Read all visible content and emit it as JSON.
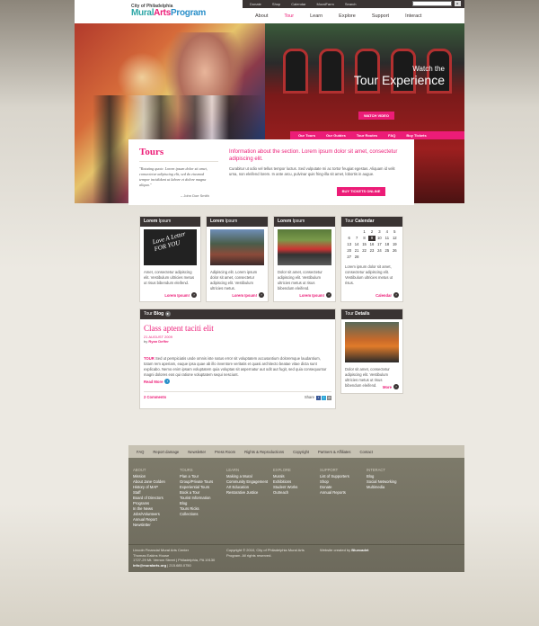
{
  "header": {
    "logo_top": "City of Philadelphia",
    "logo_a": "Mural",
    "logo_b": "Arts",
    "logo_c": "Program",
    "utility": [
      "Donate",
      "Shop",
      "Calendar",
      "MuralFarm"
    ],
    "search_label": "Search",
    "nav": [
      "About",
      "Tour",
      "Learn",
      "Explore",
      "Support",
      "Interact"
    ],
    "nav_active": "Tour"
  },
  "hero": {
    "watch": "Watch the",
    "experience": "Tour Experience",
    "watch_button": "WATCH VIDEO"
  },
  "subnav": [
    "Our Tours",
    "Our Guides",
    "Tour Routes",
    "FAQ",
    "Buy Tickets"
  ],
  "intro": {
    "title": "Tours",
    "quote": "\"Rotating quote. Lorem ipsum dolor sit amet, consectetur adipiscing elit, sed do eiusmod tempor incididunt ut labore et dolore magna aliqua.\"",
    "quote_by": "– John Doe Smith",
    "lead": "Information about the section. Lorem ipsum dolor sit amet, consectetur adipiscing elit.",
    "body": "Curabitur ut odio vel tellus tempor luctus. Sed vulputate mi ac tortor feugiat egestas. Aliquam id velit urna, non eleifend lorem. In ante arcu, pulvinar quis fring-illa sit amet, lobortis in augue.",
    "buy_button": "BUY TICKETS ONLINE"
  },
  "cards": [
    {
      "head_bold": "Lorem",
      "head": " Ipsum",
      "text": "Amet, consectetur adipiscing elit. Vestibulum ultricies metus ut risus bibendum eleifend.",
      "link": "Lorem Ipsum!",
      "img_text": "Love A Letter FOR YOU"
    },
    {
      "head_bold": "Lorem",
      "head": " Ipsum",
      "text": "Adipiscing elit. Lorem ipsum dolor sit amet, consectetur adipiscing elit. Vestibulum ultricies metus.",
      "link": "Lorem Ipsum!"
    },
    {
      "head_bold": "Lorem",
      "head": " Ipsum",
      "text": "Dolor sit amet, consectetur adipiscing elit. Vestibulum ultricies metus ut risus bibendum eleifend.",
      "link": "Lorem Ipsum!"
    }
  ],
  "calendar": {
    "head_pre": "Tour",
    "head_bold": " Calendar",
    "days": [
      "",
      "",
      "1",
      "2",
      "3",
      "4",
      "5",
      "6",
      "7",
      "8",
      "9",
      "10",
      "11",
      "12",
      "13",
      "14",
      "15",
      "16",
      "17",
      "18",
      "19",
      "20",
      "21",
      "22",
      "23",
      "24",
      "25",
      "26",
      "27",
      "28"
    ],
    "today": "9",
    "text": "Lorem ipsum dolor sit amet, consectetur adipiscing elit. Vestibulum ultricies metus ut risus.",
    "link": "Calendar"
  },
  "blog": {
    "head_pre": "Tour",
    "head_bold": " Blog",
    "title": "Class aptent taciti elit",
    "date": "21 AUGUST 2009",
    "by_label": "by",
    "author": "Ryan Deffer",
    "body_lead": "TOUR",
    "body": " Sed ut perspiciatis unde omnis iste natus error sit voluptatem accusantium doloremque laudantium, totam rem aperiam, eaque ipsa quae ab illo inventore veritatis et quasi architecto beatae vitae dicta sunt explicabo. Nemo enim ipsam voluptatem quia voluptas sit aspernatur aut odit aut fugit, sed quia consequuntur magni dolores eos qui ratione voluptatem sequi nesciunt.",
    "read_more": "Read More",
    "comments_count": "2",
    "comments_label": " Comments",
    "share": "Share"
  },
  "details": {
    "head_pre": "Tour",
    "head_bold": " Details",
    "text": "Dolor sit amet, consectetur adipiscing elit. Vestibulum ultricies metus ut risus bibendum eleifend.",
    "link": "More"
  },
  "footer_bar": [
    "FAQ",
    "Report damage",
    "Newsletter",
    "Press Room",
    "Rights & Reproductions",
    "Copyright",
    "Partners & Affiliates",
    "Contact"
  ],
  "footer_cols": [
    {
      "head": "About",
      "items": [
        "Mission",
        "About Jane Golden",
        "History of MAP",
        "Staff",
        "Board of Directors",
        "Programs",
        "In the News",
        "Jobs/Volunteers",
        "Annual Report",
        "Newsletter"
      ]
    },
    {
      "head": "Tours",
      "items": [
        "Plan a Tour",
        "Group/Private Tours",
        "Experiential Tours",
        "Book a Tour",
        "Tourist Information",
        "Blog",
        "Tours Ricks",
        "Collections"
      ]
    },
    {
      "head": "Learn",
      "items": [
        "Making a Mural",
        "Community Engagement",
        "Art Education",
        "Restorative Justice"
      ]
    },
    {
      "head": "Explore",
      "items": [
        "Murals",
        "Exhibitions",
        "Student Works",
        "Outreach"
      ]
    },
    {
      "head": "Support",
      "items": [
        "List of Supporters",
        "Shop",
        "Donate",
        "Annual Reports"
      ]
    },
    {
      "head": "Interact",
      "items": [
        "Blog",
        "Social Networking",
        "Multimedia"
      ]
    }
  ],
  "footer_bottom": {
    "address_1": "Lincoln Financial Mural Arts Center",
    "address_2": "Thomas Eakins House",
    "address_3": "1727-29 Mt. Vernon Street | Philadelphia, PA 19130",
    "email": "info@muralarts.org",
    "phone": " | 215.685.0750",
    "copyright": "Copyright © 2010, City of Philadelphia Mural Arts Program. All rights reserved.",
    "credit_pre": "Website created by ",
    "credit_name": "Bluecadet"
  }
}
